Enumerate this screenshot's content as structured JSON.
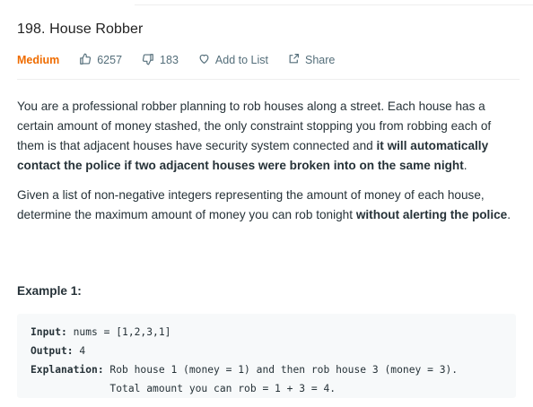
{
  "problem": {
    "title": "198. House Robber",
    "difficulty": "Medium",
    "likes": "6257",
    "dislikes": "183",
    "add_to_list_label": "Add to List",
    "share_label": "Share",
    "difficulty_color": "#ef6c00"
  },
  "description": {
    "p1_part1": "You are a professional robber planning to rob houses along a street. Each house has a certain amount of money stashed, the only constraint stopping you from robbing each of them is that adjacent houses have security system connected and ",
    "p1_bold": "it will automatically contact the police if two adjacent houses were broken into on the same night",
    "p1_end": ".",
    "p2_part1": "Given a list of non-negative integers representing the amount of money of each house, determine the maximum amount of money you can rob tonight ",
    "p2_bold": "without alerting the police",
    "p2_end": "."
  },
  "example": {
    "heading": "Example 1:",
    "input_label": "Input:",
    "input_value": " nums = [1,2,3,1]",
    "output_label": "Output:",
    "output_value": " 4",
    "explanation_label": "Explanation:",
    "explanation_line1": " Rob house 1 (money = 1) and then rob house 3 (money = 3).",
    "explanation_line2": "             Total amount you can rob = 1 + 3 = 4."
  },
  "icons": {
    "like": "thumbs-up-icon",
    "dislike": "thumbs-down-icon",
    "add_to_list": "heart-icon",
    "share": "share-icon"
  }
}
